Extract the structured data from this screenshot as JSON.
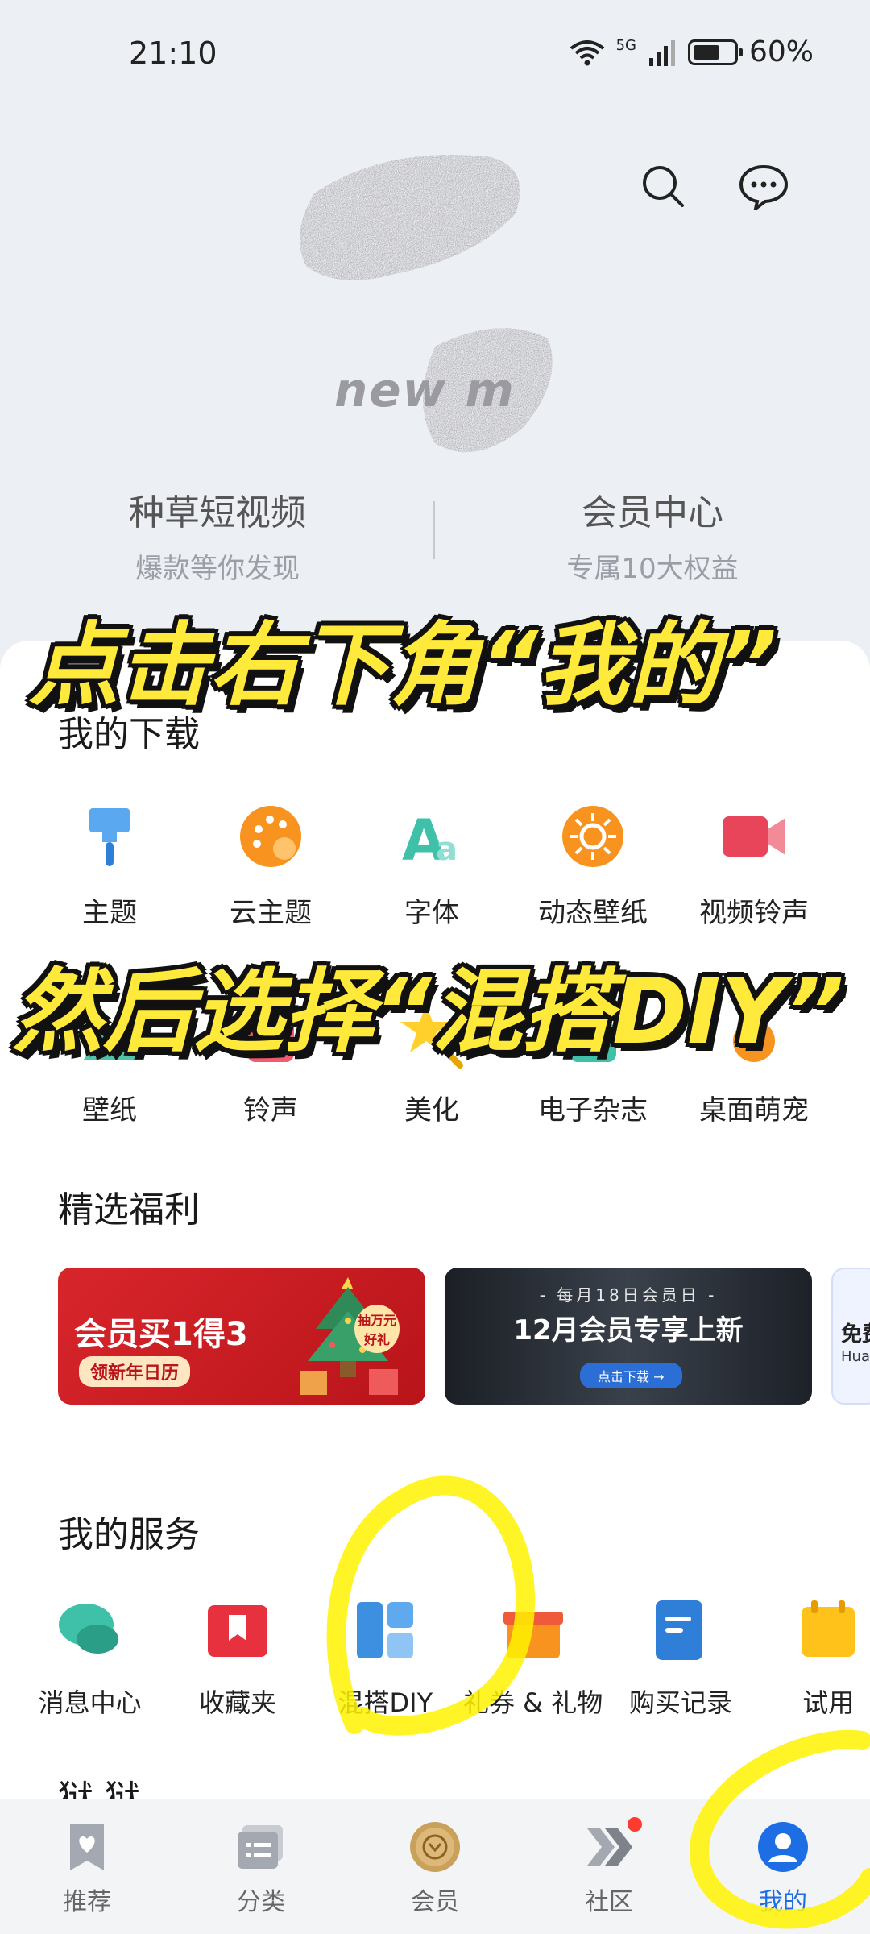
{
  "status_bar": {
    "time": "21:10",
    "network": "5G",
    "battery": "60%"
  },
  "header": {
    "logo_text": "new m"
  },
  "promos": [
    {
      "title": "种草短视频",
      "subtitle": "爆款等你发现"
    },
    {
      "title": "会员中心",
      "subtitle": "专属10大权益"
    }
  ],
  "downloads": {
    "title": "我的下载",
    "row1": [
      {
        "label": "主题",
        "icon": "brush-icon"
      },
      {
        "label": "云主题",
        "icon": "palette-icon"
      },
      {
        "label": "字体",
        "icon": "font-icon"
      },
      {
        "label": "动态壁纸",
        "icon": "live-wallpaper-icon"
      },
      {
        "label": "视频铃声",
        "icon": "video-ringtone-icon"
      }
    ],
    "row2": [
      {
        "label": "壁纸",
        "icon": "wallpaper-icon"
      },
      {
        "label": "铃声",
        "icon": "ringtone-icon"
      },
      {
        "label": "美化",
        "icon": "star-wand-icon"
      },
      {
        "label": "电子杂志",
        "icon": "magazine-icon"
      },
      {
        "label": "桌面萌宠",
        "icon": "pet-icon"
      }
    ]
  },
  "welfare": {
    "title": "精选福利",
    "banner1": {
      "headline": "会员买1得3",
      "sub": "领新年日历",
      "tag": "抽万元好礼"
    },
    "banner2": {
      "top": "- 每月18日会员日 -",
      "headline": "12月会员专享上新",
      "button": "点击下载 →"
    },
    "banner3": {
      "text": "免费",
      "small": "Hua"
    }
  },
  "services": {
    "title": "我的服务",
    "items": [
      {
        "label": "消息中心",
        "icon": "message-icon"
      },
      {
        "label": "收藏夹",
        "icon": "bookmark-icon"
      },
      {
        "label": "混搭DIY",
        "icon": "mix-diy-icon"
      },
      {
        "label": "礼券 & 礼物",
        "icon": "gift-icon"
      },
      {
        "label": "购买记录",
        "icon": "purchase-record-icon"
      },
      {
        "label": "试用",
        "icon": "trial-icon"
      }
    ]
  },
  "partial_section": "狱 狱",
  "bottom_nav": [
    {
      "label": "推荐",
      "icon": "recommend-icon"
    },
    {
      "label": "分类",
      "icon": "category-icon"
    },
    {
      "label": "会员",
      "icon": "vip-icon"
    },
    {
      "label": "社区",
      "icon": "community-icon"
    },
    {
      "label": "我的",
      "icon": "profile-icon",
      "active": true
    }
  ],
  "annotations": {
    "caption1": "点击右下角“我的”",
    "caption2": "然后选择“混搭DIY”"
  },
  "colors": {
    "accent": "#1d6ee5",
    "highlight": "#fff200",
    "caption": "#ffe93a"
  }
}
